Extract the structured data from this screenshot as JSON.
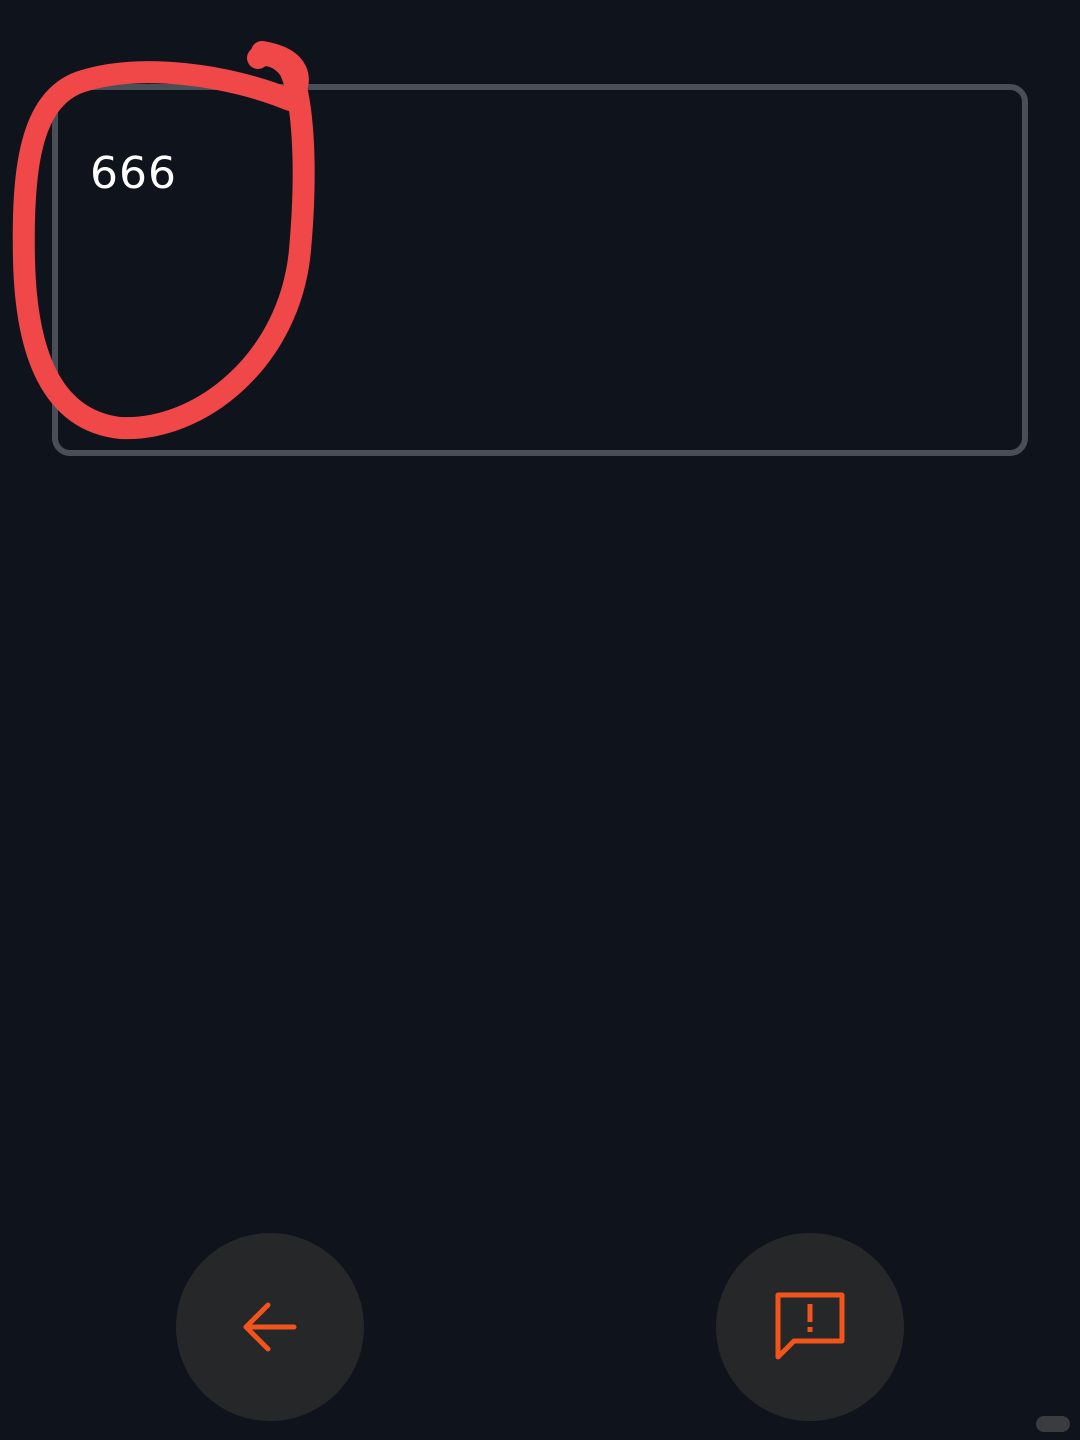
{
  "input": {
    "value": "666"
  },
  "buttons": {
    "back": {
      "icon": "arrow-left-icon"
    },
    "report": {
      "icon": "report-feedback-icon"
    }
  },
  "annotation": {
    "color": "#f04848"
  },
  "colors": {
    "background": "#0f131c",
    "field_border": "#4a4e56",
    "button_bg": "#262729",
    "accent": "#f2541b"
  }
}
